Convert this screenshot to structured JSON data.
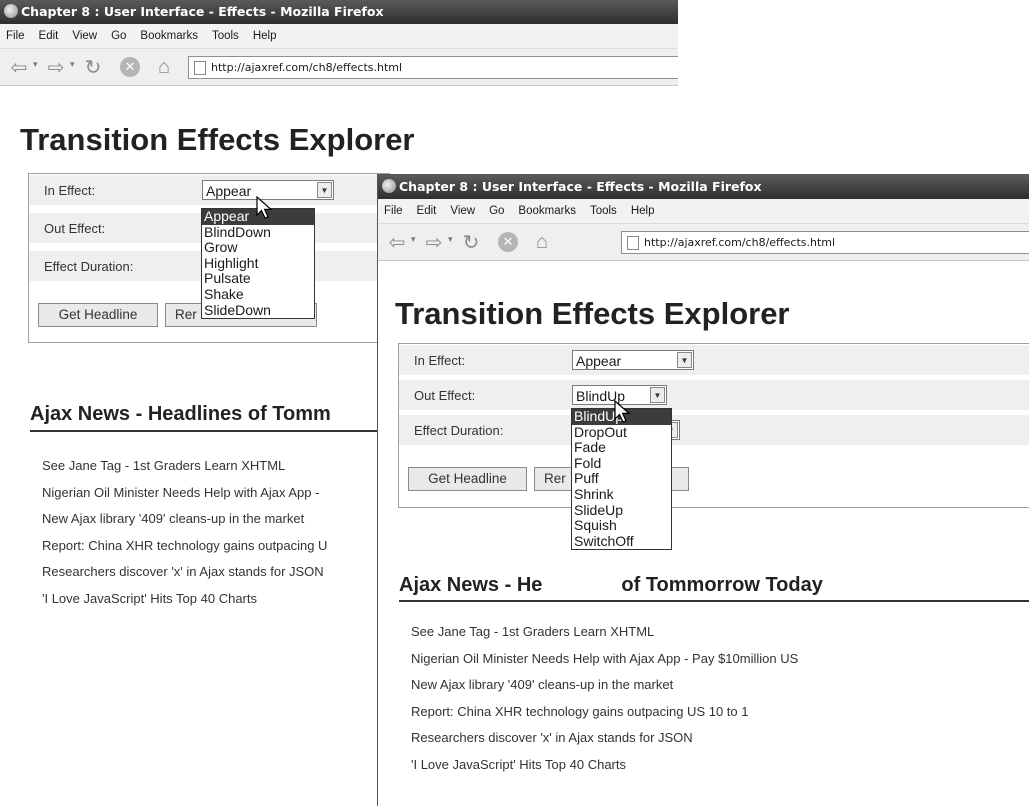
{
  "window": {
    "title": "Chapter 8 : User Interface - Effects - Mozilla Firefox",
    "menu": [
      "File",
      "Edit",
      "View",
      "Go",
      "Bookmarks",
      "Tools",
      "Help"
    ],
    "url": "http://ajaxref.com/ch8/effects.html"
  },
  "page": {
    "title": "Transition Effects Explorer",
    "labels": {
      "in_effect": "In Effect:",
      "out_effect": "Out Effect:",
      "duration": "Effect Duration:"
    },
    "buttons": {
      "get_headline": "Get Headline",
      "remove": "Remove Headline",
      "remove_partial": "Rer"
    },
    "news_title": "Ajax News - Headlines of Tommorrow Today",
    "news_title_part1": "Ajax News - Headlines of Tomm",
    "news_title_w2_part1": "Ajax News - He",
    "news_title_w2_part2": "of Tommorrow Today",
    "headlines": [
      "See Jane Tag - 1st Graders Learn XHTML",
      "Nigerian Oil Minister Needs Help with Ajax App - Pay $10million US",
      "New Ajax library '409' cleans-up in the market",
      "Report: China XHR technology gains outpacing US 10 to 1",
      "Researchers discover 'x' in Ajax stands for JSON",
      "'I Love JavaScript' Hits Top 40 Charts"
    ],
    "headlines_w1": [
      "See Jane Tag - 1st Graders Learn XHTML",
      "Nigerian Oil Minister Needs Help with Ajax App -",
      "New Ajax library '409' cleans-up in the market",
      "Report: China XHR technology gains outpacing U",
      "Researchers discover 'x' in Ajax stands for JSON",
      "'I Love JavaScript' Hits Top 40 Charts"
    ]
  },
  "window1": {
    "in_effect_value": "Appear",
    "in_effect_options": [
      "Appear",
      "BlindDown",
      "Grow",
      "Highlight",
      "Pulsate",
      "Shake",
      "SlideDown"
    ],
    "highlighted_option": "Appear"
  },
  "window2": {
    "in_effect_value": "Appear",
    "out_effect_value": "BlindUp",
    "out_effect_options": [
      "BlindUp",
      "DropOut",
      "Fade",
      "Fold",
      "Puff",
      "Shrink",
      "SlideUp",
      "Squish",
      "SwitchOff"
    ],
    "highlighted_option": "BlindUp"
  },
  "icons": [
    "firefox-icon",
    "back-icon",
    "forward-icon",
    "reload-icon",
    "stop-icon",
    "home-icon",
    "page-icon",
    "select-arrow-icon",
    "mouse-cursor-icon"
  ]
}
